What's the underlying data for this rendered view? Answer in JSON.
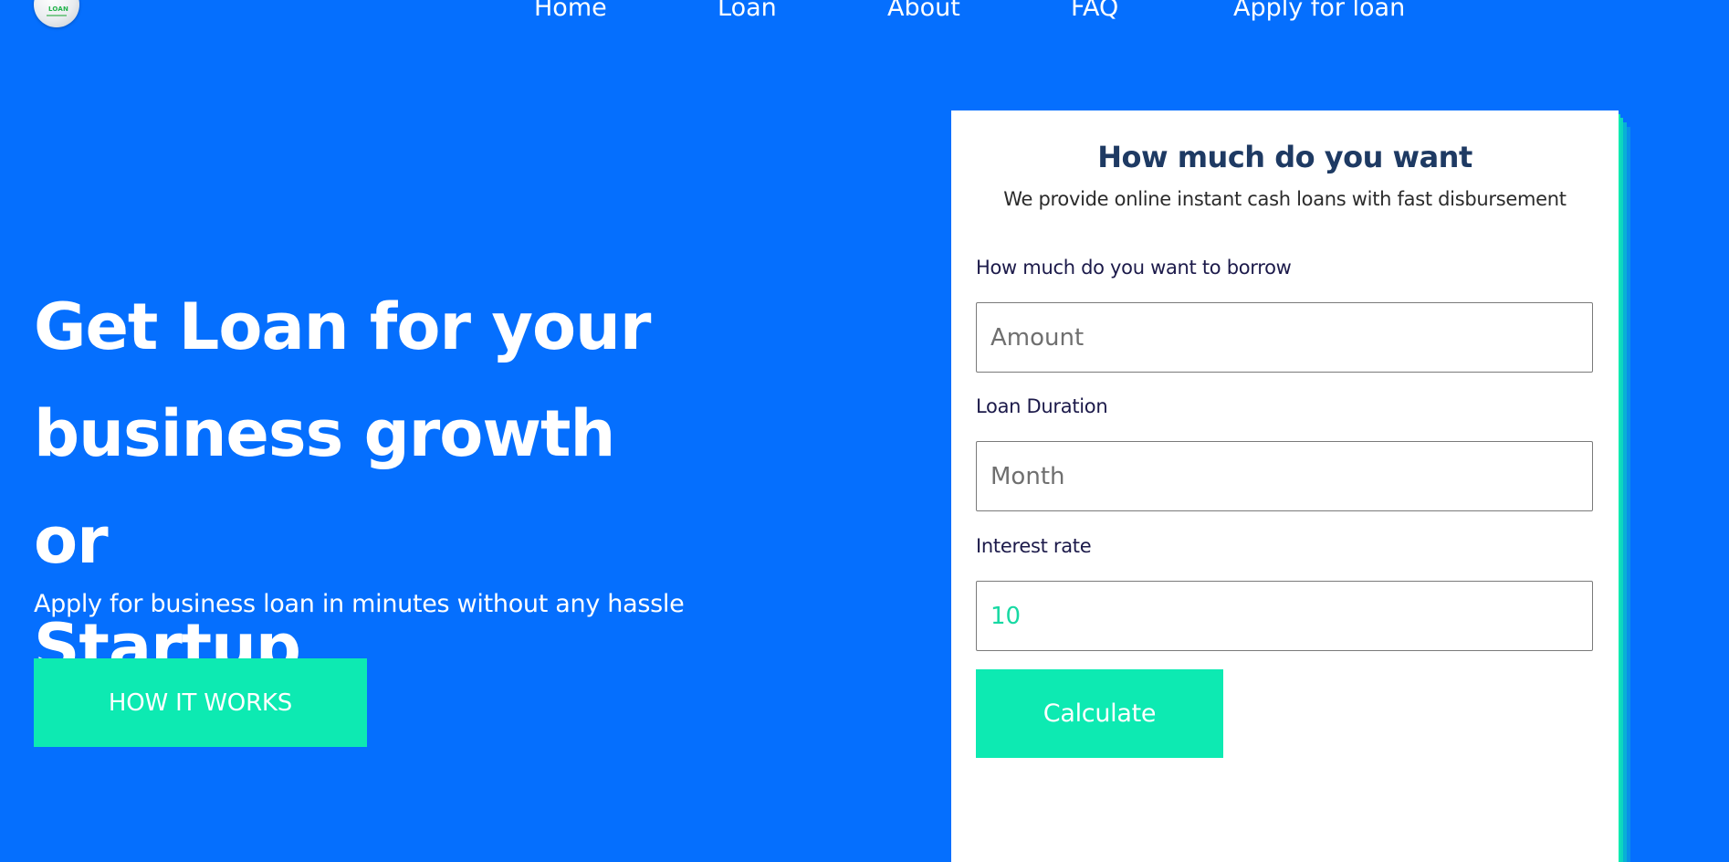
{
  "colors": {
    "background": "#056ffe",
    "accent": "#0deab2",
    "card_title": "#1e3a63",
    "stack_shadows": [
      "#0a8fe8",
      "#08b0d6",
      "#0dd6c0",
      "#0deab2"
    ]
  },
  "header": {
    "logo_text": "LOAN",
    "logo_icon": "loan-logo-icon",
    "nav": [
      "Home",
      "Loan",
      "About",
      "FAQ",
      "Apply for loan"
    ]
  },
  "hero": {
    "title_lines": [
      "Get Loan for your",
      "business growth or",
      "Startup"
    ],
    "subtitle": "Apply for business loan in minutes without any hassle",
    "cta_label": "HOW IT WORKS"
  },
  "calculator": {
    "title": "How much do you want",
    "description": "We provide online instant cash loans with fast disbursement",
    "amount_label": "How much do you want to borrow",
    "amount_placeholder": "Amount",
    "duration_label": "Loan Duration",
    "duration_placeholder": "Month",
    "rate_label": "Interest rate",
    "rate_value": "10",
    "calculate_label": "Calculate"
  }
}
